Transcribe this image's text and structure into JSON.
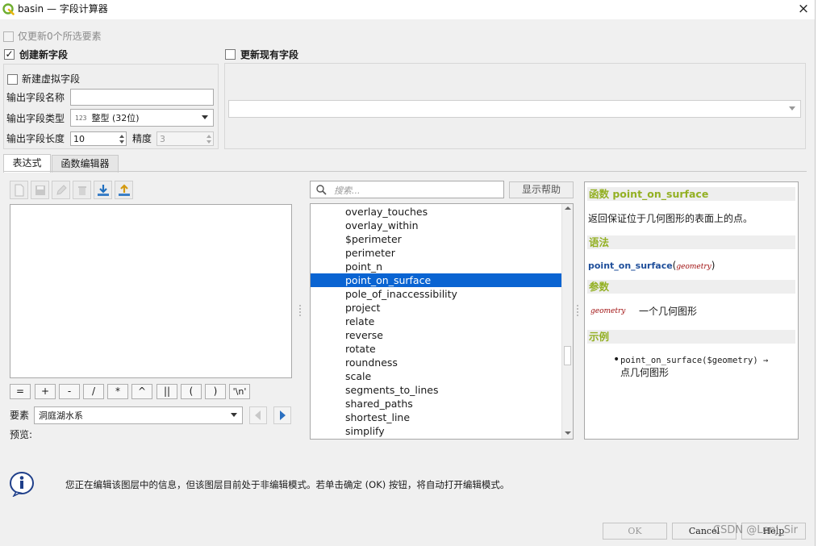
{
  "window": {
    "title": "basin — 字段计算器",
    "close_icon": "×"
  },
  "options": {
    "update_selected_label": "仅更新0个所选要素",
    "create_new_field_label": "创建新字段",
    "create_new_field_checked": "✓",
    "update_existing_field_label": "更新现有字段",
    "virtual_field_label": "新建虚拟字段",
    "output_name_label": "输出字段名称",
    "output_name_value": "",
    "output_type_label": "输出字段类型",
    "output_type_icon": "123",
    "output_type_value": "整型 (32位)",
    "output_length_label": "输出字段长度",
    "output_length_value": "10",
    "precision_label": "精度",
    "precision_value": "3",
    "existing_field_value": ""
  },
  "tabs": [
    {
      "label": "表达式",
      "active": true
    },
    {
      "label": "函数编辑器",
      "active": false
    }
  ],
  "toolbar": {
    "icons": [
      "new-file-icon",
      "save-icon",
      "edit-icon",
      "delete-icon",
      "import-icon",
      "export-icon"
    ]
  },
  "expression": {
    "text": ""
  },
  "operators": [
    "=",
    "+",
    "-",
    "/",
    "*",
    "^",
    "||",
    "(",
    ")",
    "'\\n'"
  ],
  "feature": {
    "label": "要素",
    "value": "洞庭湖水系",
    "preview_label": "预览:"
  },
  "search": {
    "placeholder": "搜索...",
    "show_help_label": "显示帮助"
  },
  "functions": {
    "items": [
      "overlay_touches",
      "overlay_within",
      "$perimeter",
      "perimeter",
      "point_n",
      "point_on_surface",
      "pole_of_inaccessibility",
      "project",
      "relate",
      "reverse",
      "rotate",
      "roundness",
      "scale",
      "segments_to_lines",
      "shared_paths",
      "shortest_line",
      "simplify"
    ],
    "selected": "point_on_surface"
  },
  "help": {
    "title": "函数 point_on_surface",
    "description": "返回保证位于几何图形的表面上的点。",
    "syntax_header": "语法",
    "syntax_fn": "point_on_surface",
    "syntax_paren_open": "(",
    "syntax_arg": "geometry",
    "syntax_paren_close": ")",
    "params_header": "参数",
    "param_name": "geometry",
    "param_desc": "一个几何图形",
    "examples_header": "示例",
    "example_code": "point_on_surface($geometry) →",
    "example_result": "点几何图形"
  },
  "info": {
    "message": "您正在编辑该图层中的信息，但该图层目前处于非编辑模式。若单击确定 (OK) 按钮，将自动打开编辑模式。"
  },
  "buttons": {
    "ok": "OK",
    "cancel": "Cancel",
    "help": "Help"
  },
  "watermark": "CSDN @LenJ_Sir",
  "colors": {
    "accent": "#93b023",
    "selection": "#0a64d2",
    "link": "#1e4e9a",
    "param": "#a01010"
  }
}
